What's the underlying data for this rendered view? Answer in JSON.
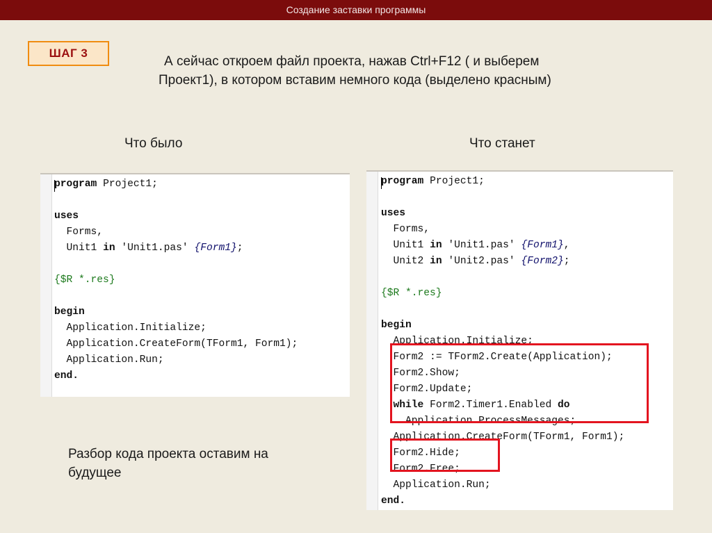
{
  "header": {
    "title": "Создание заставки программы"
  },
  "step": {
    "label": "ШАГ 3"
  },
  "intro": {
    "line1": "А сейчас откроем файл проекта, нажав Ctrl+F12 ( и выберем",
    "line2": "Проект1), в котором вставим немного кода (выделено красным)"
  },
  "columns": {
    "before": "Что было",
    "after": "Что станет"
  },
  "before_code": [
    [
      {
        "t": "program",
        "k": "kw"
      },
      {
        "t": " Project1;"
      }
    ],
    [],
    [
      {
        "t": "uses",
        "k": "kw"
      }
    ],
    [
      {
        "t": "  Forms,"
      }
    ],
    [
      {
        "t": "  Unit1 "
      },
      {
        "t": "in",
        "k": "kw"
      },
      {
        "t": " 'Unit1.pas' "
      },
      {
        "t": "{Form1}",
        "k": "cm"
      },
      {
        "t": ";"
      }
    ],
    [],
    [
      {
        "t": "{$R *.res}",
        "k": "dr"
      }
    ],
    [],
    [
      {
        "t": "begin",
        "k": "kw"
      }
    ],
    [
      {
        "t": "  Application.Initialize;"
      }
    ],
    [
      {
        "t": "  Application.CreateForm(TForm1, Form1);"
      }
    ],
    [
      {
        "t": "  Application.Run;"
      }
    ],
    [
      {
        "t": "end.",
        "k": "kw"
      }
    ]
  ],
  "after_code": [
    [
      {
        "t": "program",
        "k": "kw"
      },
      {
        "t": " Project1;"
      }
    ],
    [],
    [
      {
        "t": "uses",
        "k": "kw"
      }
    ],
    [
      {
        "t": "  Forms,"
      }
    ],
    [
      {
        "t": "  Unit1 "
      },
      {
        "t": "in",
        "k": "kw"
      },
      {
        "t": " 'Unit1.pas' "
      },
      {
        "t": "{Form1}",
        "k": "cm"
      },
      {
        "t": ","
      }
    ],
    [
      {
        "t": "  Unit2 "
      },
      {
        "t": "in",
        "k": "kw"
      },
      {
        "t": " 'Unit2.pas' "
      },
      {
        "t": "{Form2}",
        "k": "cm"
      },
      {
        "t": ";"
      }
    ],
    [],
    [
      {
        "t": "{$R *.res}",
        "k": "dr"
      }
    ],
    [],
    [
      {
        "t": "begin",
        "k": "kw"
      }
    ],
    [
      {
        "t": "  Application.Initialize;"
      }
    ],
    [
      {
        "t": "  Form2 := TForm2.Create(Application);"
      }
    ],
    [
      {
        "t": "  Form2.Show;"
      }
    ],
    [
      {
        "t": "  Form2.Update;"
      }
    ],
    [
      {
        "t": "  "
      },
      {
        "t": "while",
        "k": "kw"
      },
      {
        "t": " Form2.Timer1.Enabled "
      },
      {
        "t": "do",
        "k": "kw"
      }
    ],
    [
      {
        "t": "    Application.ProcessMessages;"
      }
    ],
    [
      {
        "t": "  Application.CreateForm(TForm1, Form1);"
      }
    ],
    [
      {
        "t": "  Form2.Hide;"
      }
    ],
    [
      {
        "t": "  Form2.Free;"
      }
    ],
    [
      {
        "t": "  Application.Run;"
      }
    ],
    [
      {
        "t": "end.",
        "k": "kw"
      }
    ]
  ],
  "note": "Разбор кода проекта оставим на будущее",
  "colors": {
    "title_bar": "#7b0c0c",
    "highlight": "#e3141f",
    "badge_border": "#f08c10"
  }
}
